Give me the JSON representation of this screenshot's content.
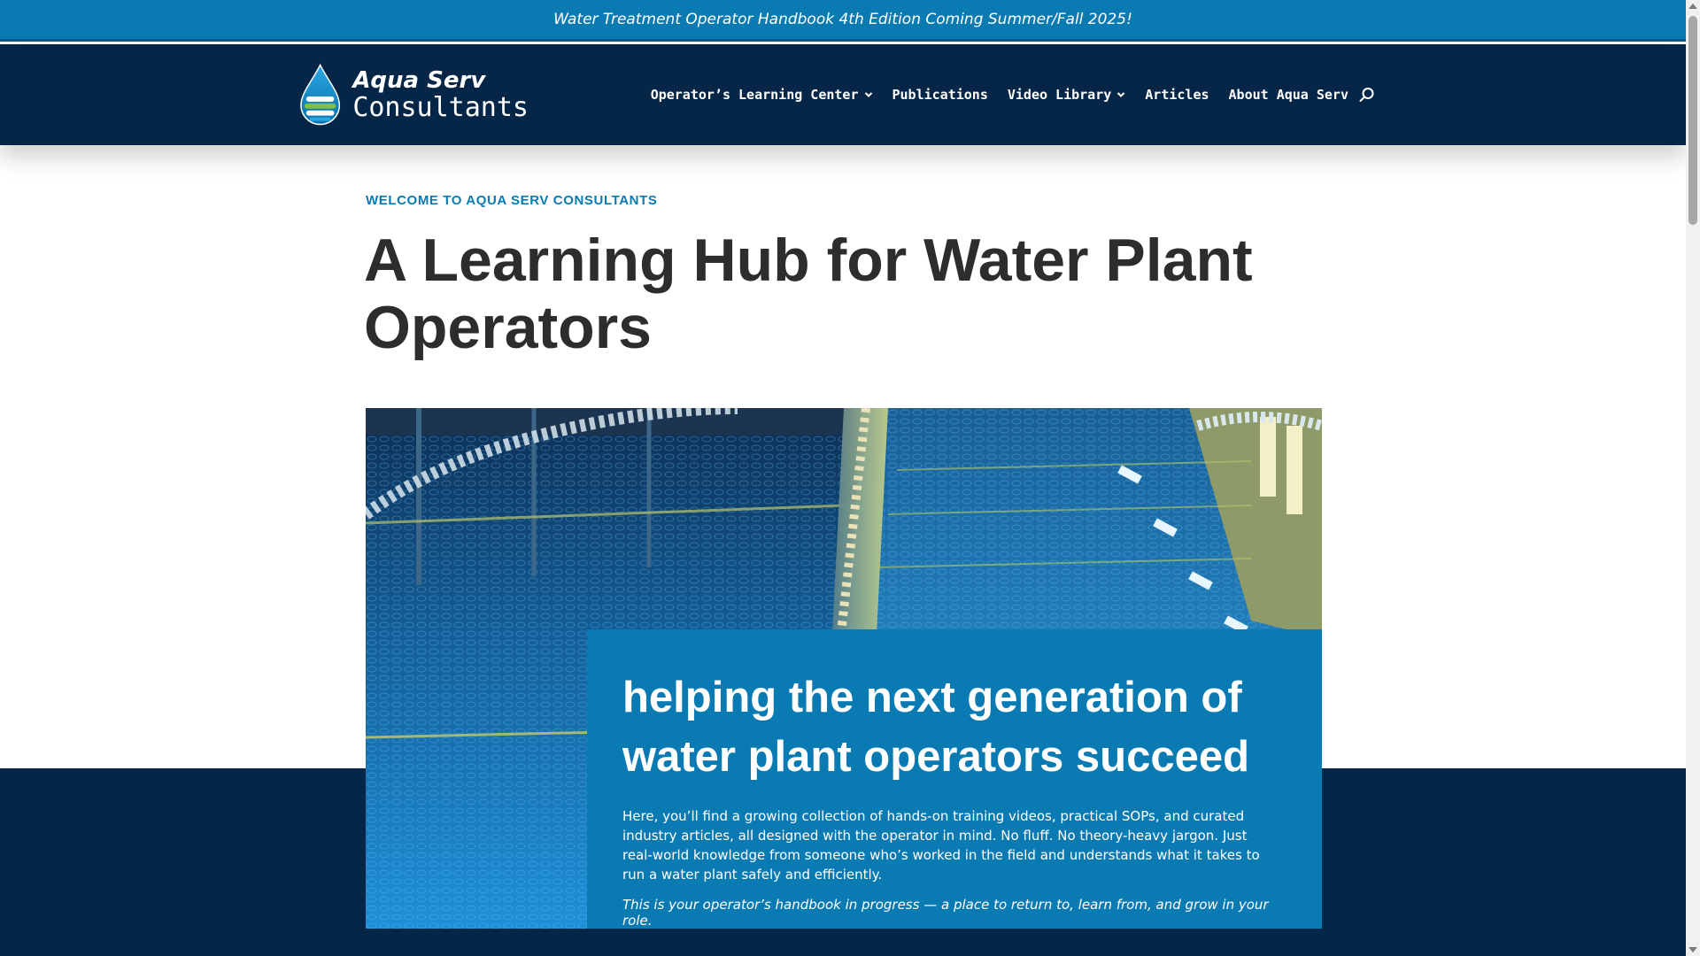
{
  "announcement": {
    "text": "Water Treatment Operator Handbook 4th Edition Coming Summer/Fall 2025!"
  },
  "brand": {
    "line1": "Aqua Serv",
    "line2": "Consultants",
    "logo_icon": "water-drop-icon"
  },
  "nav": {
    "items": [
      {
        "label": "Operator’s Learning Center",
        "has_dropdown": true
      },
      {
        "label": "Publications",
        "has_dropdown": false
      },
      {
        "label": "Video Library",
        "has_dropdown": true
      },
      {
        "label": "Articles",
        "has_dropdown": false
      },
      {
        "label": "About Aqua Serv",
        "has_dropdown": false
      }
    ],
    "search_icon": "search-icon"
  },
  "intro": {
    "eyebrow": "WELCOME TO AQUA SERV CONSULTANTS",
    "headline": "A Learning Hub for Water Plant Operators"
  },
  "hero_card": {
    "title": "helping the next generation of water plant operators succeed",
    "body": "Here, you’ll find a growing collection of hands-on training videos, practical SOPs, and curated industry articles, all designed with the operator in mind. No fluff. No theory-heavy jargon. Just real-world knowledge from someone who’s worked in the field and understands what it takes to run a water plant safely and efficiently.",
    "tagline": "This is your operator’s handbook in progress — a place to return to, learn from, and grow in your role."
  },
  "colors": {
    "accent_blue": "#0a7ab3",
    "navy": "#062647",
    "heading_text": "#2d2d2d"
  }
}
